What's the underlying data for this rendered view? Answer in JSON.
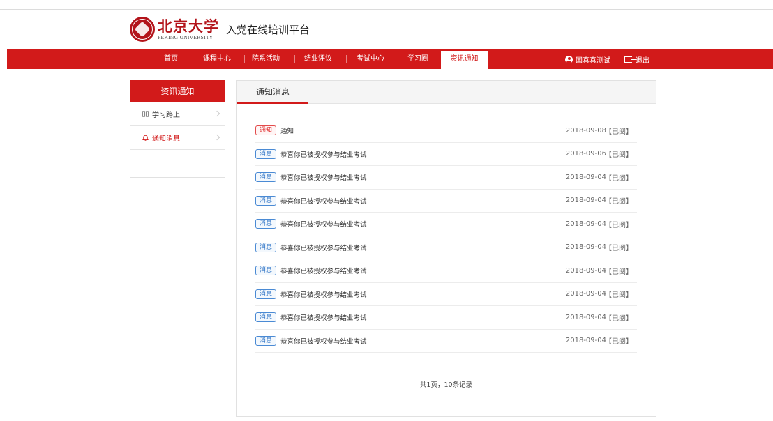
{
  "header": {
    "logo_cn": "北京大学",
    "logo_en": "PEKING UNIVERSITY",
    "platform_title": "入党在线培训平台"
  },
  "nav": {
    "items": [
      {
        "label": "首页"
      },
      {
        "label": "课程中心"
      },
      {
        "label": "院系活动"
      },
      {
        "label": "结业评议"
      },
      {
        "label": "考试中心"
      },
      {
        "label": "学习圈"
      },
      {
        "label": "资讯通知"
      }
    ],
    "active": "资讯通知",
    "user_name": "国真真测试",
    "logout_label": "退出"
  },
  "sidebar": {
    "title": "资讯通知",
    "items": [
      {
        "label": "学习路上",
        "icon": "book-icon"
      },
      {
        "label": "通知消息",
        "icon": "bell-icon",
        "active": true
      }
    ]
  },
  "main": {
    "title": "通知消息",
    "messages": [
      {
        "tag": "通知",
        "type": "notice",
        "title": "通知",
        "date": "2018-09-08",
        "status": "【已阅】"
      },
      {
        "tag": "消息",
        "type": "message",
        "title": "恭喜你已被授权参与结业考试",
        "date": "2018-09-06",
        "status": "【已阅】"
      },
      {
        "tag": "消息",
        "type": "message",
        "title": "恭喜你已被授权参与结业考试",
        "date": "2018-09-04",
        "status": "【已阅】"
      },
      {
        "tag": "消息",
        "type": "message",
        "title": "恭喜你已被授权参与结业考试",
        "date": "2018-09-04",
        "status": "【已阅】"
      },
      {
        "tag": "消息",
        "type": "message",
        "title": "恭喜你已被授权参与结业考试",
        "date": "2018-09-04",
        "status": "【已阅】"
      },
      {
        "tag": "消息",
        "type": "message",
        "title": "恭喜你已被授权参与结业考试",
        "date": "2018-09-04",
        "status": "【已阅】"
      },
      {
        "tag": "消息",
        "type": "message",
        "title": "恭喜你已被授权参与结业考试",
        "date": "2018-09-04",
        "status": "【已阅】"
      },
      {
        "tag": "消息",
        "type": "message",
        "title": "恭喜你已被授权参与结业考试",
        "date": "2018-09-04",
        "status": "【已阅】"
      },
      {
        "tag": "消息",
        "type": "message",
        "title": "恭喜你已被授权参与结业考试",
        "date": "2018-09-04",
        "status": "【已阅】"
      },
      {
        "tag": "消息",
        "type": "message",
        "title": "恭喜你已被授权参与结业考试",
        "date": "2018-09-04",
        "status": "【已阅】"
      }
    ],
    "pagination": "共1页，10条记录"
  },
  "colors": {
    "brand_red": "#d21a1a",
    "message_blue": "#2f74c6",
    "notice_red": "#e03030"
  }
}
